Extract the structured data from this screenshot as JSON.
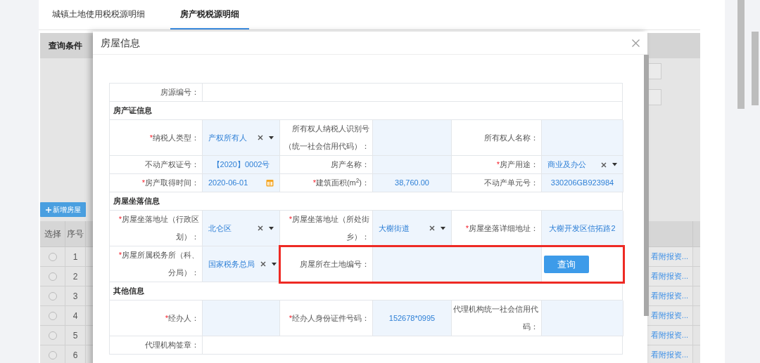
{
  "tabs": [
    {
      "label": "城镇土地使用税税源明细",
      "selected": false
    },
    {
      "label": "房产税税源明细",
      "selected": true
    }
  ],
  "query_panel": {
    "title": "查询条件",
    "add_button": "新增房屋"
  },
  "table": {
    "columns": [
      "选择",
      "序号"
    ],
    "rows": [
      {
        "index": "1",
        "selected": false,
        "action": "看附报资..."
      },
      {
        "index": "2",
        "selected": false,
        "action": "看附报资..."
      },
      {
        "index": "3",
        "selected": false,
        "action": "看附报资..."
      },
      {
        "index": "4",
        "selected": false,
        "action": "看附报资..."
      },
      {
        "index": "5",
        "selected": false,
        "action": "看附报资..."
      },
      {
        "index": "6",
        "selected": false,
        "action": "看附报资..."
      }
    ]
  },
  "dialog": {
    "title": "房屋信息",
    "rows": [
      {
        "kind": "full",
        "label": "房源编号："
      },
      {
        "kind": "section",
        "title": "房产证信息"
      },
      {
        "kind": "fields",
        "fields": [
          {
            "label": "纳税人类型：",
            "required_mark": "*",
            "kind": "select",
            "value": "产权所有人"
          },
          {
            "label": "所有权人纳税人识别号（统一社会信用代码）：",
            "kind": "input"
          },
          {
            "label": "所有权人名称：",
            "kind": "input"
          }
        ]
      },
      {
        "kind": "fields",
        "fields": [
          {
            "label": "不动产权证号：",
            "kind": "text",
            "value": "【2020】0002号"
          },
          {
            "label": "房产名称：",
            "kind": "input"
          },
          {
            "label": "房产用途：",
            "required_mark": "*",
            "kind": "select",
            "value": "商业及办公"
          }
        ]
      },
      {
        "kind": "fields",
        "fields": [
          {
            "label": "房产取得时间：",
            "required_mark": "*",
            "kind": "date",
            "value": "2020-06-01"
          },
          {
            "label": "建筑面积(m$^{2}$)：",
            "required_mark": "*",
            "kind": "text",
            "value": "38,760.00"
          },
          {
            "label": "不动产单元号：",
            "kind": "text",
            "value": "330206GB923984"
          }
        ]
      },
      {
        "kind": "section",
        "title": "房屋坐落信息"
      },
      {
        "kind": "fields",
        "fields": [
          {
            "label": "房屋坐落地址（行政区划）：",
            "required_mark": "*",
            "kind": "select",
            "value": "北仑区"
          },
          {
            "label": "房屋坐落地址（所处街乡）：",
            "required_mark": "*",
            "kind": "select",
            "value": "大榭街道"
          },
          {
            "label": "房屋坐落详细地址：",
            "required_mark": "*",
            "kind": "text",
            "value": "大榭开发区信拓路2"
          }
        ]
      },
      {
        "kind": "fields",
        "fields": [
          {
            "label": "房屋所属税务所（科、分局）：",
            "required_mark": "*",
            "kind": "select",
            "value": "国家税务总局"
          },
          {
            "label": "房屋所在土地编号：",
            "kind": "input",
            "wide": true,
            "highlighted": true
          },
          {
            "kind": "button",
            "label": "查询",
            "highlighted": true
          }
        ]
      },
      {
        "kind": "section",
        "title": "其他信息"
      },
      {
        "kind": "fields",
        "fields": [
          {
            "label": "经办人：",
            "required_mark": "*",
            "kind": "input"
          },
          {
            "label": "经办人身份证件号码：",
            "required_mark": "*",
            "kind": "text",
            "value": "152678*0995"
          },
          {
            "label": "代理机构统一社会信用代码：",
            "kind": "input"
          }
        ]
      },
      {
        "kind": "full",
        "label": "代理机构签章："
      }
    ]
  }
}
